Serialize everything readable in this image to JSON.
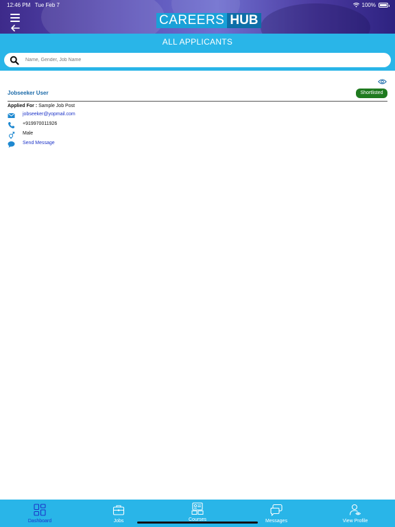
{
  "status_bar": {
    "time": "12:46 PM",
    "date": "Tue Feb 7",
    "battery": "100%"
  },
  "header": {
    "logo_part1": "CAREERS",
    "logo_part2": "HUB",
    "title": "ALL APPLICANTS"
  },
  "search": {
    "placeholder": "Name, Gender, Job Name",
    "value": ""
  },
  "applicant": {
    "name": "Jobseeker User",
    "status": "Shortlisted",
    "applied_for_label": "Applied For :",
    "applied_for_value": "Sample Job Post",
    "email": "jobseeker@yopmail.com",
    "phone": "+919970011926",
    "gender": "Male",
    "message_action": "Send Message"
  },
  "bottom_nav": {
    "items": [
      {
        "label": "Dashboard",
        "icon": "dashboard-icon",
        "active": true
      },
      {
        "label": "Jobs",
        "icon": "briefcase-icon",
        "active": false
      },
      {
        "label": "Courses",
        "icon": "courses-icon",
        "active": false
      },
      {
        "label": "Messages",
        "icon": "messages-icon",
        "active": false
      },
      {
        "label": "View Profile",
        "icon": "profile-icon",
        "active": false
      }
    ]
  },
  "colors": {
    "accent": "#29b5e8",
    "link": "#1c33c8",
    "name": "#1b6aa8",
    "shortlisted_badge": "#1f7a1f"
  }
}
